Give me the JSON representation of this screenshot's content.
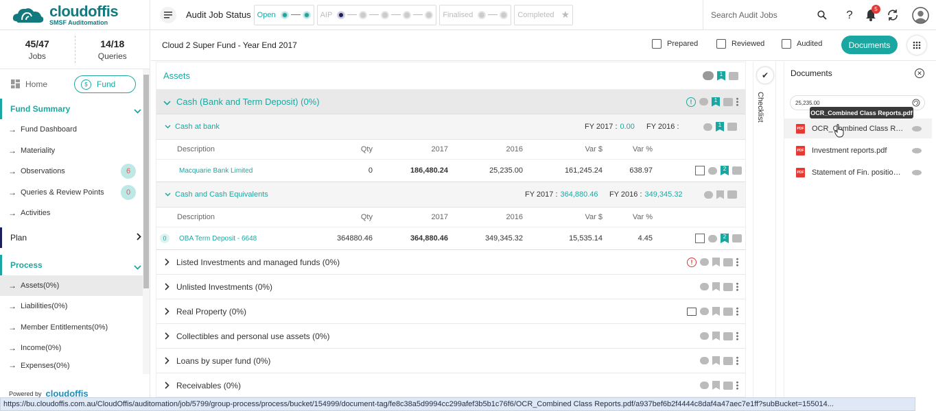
{
  "app": {
    "logo_name": "cloudoffis",
    "logo_sub": "SMSF Auditomation"
  },
  "topbar": {
    "title": "Audit Job Status",
    "stages": [
      {
        "label": "Open",
        "active": true
      },
      {
        "label": "AIP"
      },
      {
        "label": "Finalised"
      },
      {
        "label": "Completed"
      }
    ],
    "search_placeholder": "Search Audit Jobs",
    "notification_count": "5"
  },
  "sidebar": {
    "stats": [
      {
        "value": "45/47",
        "label": "Jobs"
      },
      {
        "value": "14/18",
        "label": "Queries"
      }
    ],
    "home_label": "Home",
    "fund_label": "Fund",
    "fund_icon_text": "$",
    "fund_summary_label": "Fund Summary",
    "fund_summary_items": [
      {
        "label": "Fund Dashboard"
      },
      {
        "label": "Materiality"
      },
      {
        "label": "Observations",
        "count": "6"
      },
      {
        "label": "Queries & Review Points",
        "count": "0"
      },
      {
        "label": "Activities"
      }
    ],
    "plan_label": "Plan",
    "process_label": "Process",
    "process_items": [
      {
        "label": "Assets(0%)"
      },
      {
        "label": "Liabilities(0%)"
      },
      {
        "label": "Member Entitlements(0%)"
      },
      {
        "label": "Income(0%)"
      },
      {
        "label": "Expenses(0%)"
      }
    ],
    "powered_by": "Powered by",
    "powered_brand": "cloudoffis"
  },
  "header": {
    "fund_title": "Cloud 2 Super Fund - Year End 2017",
    "prepared": "Prepared",
    "reviewed": "Reviewed",
    "audited": "Audited",
    "documents_button": "Documents"
  },
  "main": {
    "section_title": "Assets",
    "assets_flag_count": "1",
    "group": {
      "title": "Cash (Bank and Term Deposit) (0%)",
      "flag_count": "1"
    },
    "cash_at_bank": {
      "title": "Cash at bank",
      "fy2017_label": "FY 2017 :",
      "fy2017_value": "0.00",
      "fy2016_label": "FY 2016 :",
      "fy2016_value": "",
      "flag_count": "1",
      "columns": [
        "Description",
        "Qty",
        "2017",
        "2016",
        "Var $",
        "Var %"
      ],
      "rows": [
        {
          "description": "Macquarie Bank Limited",
          "qty": "0",
          "y2017": "186,480.24",
          "y2016": "25,235.00",
          "var_amt": "161,245.24",
          "var_pct": "638.97",
          "flag_count": "2"
        }
      ]
    },
    "cash_equiv": {
      "title": "Cash and Cash Equivalents",
      "fy2017_label": "FY 2017 :",
      "fy2017_value": "364,880.46",
      "fy2016_label": "FY 2016 :",
      "fy2016_value": "349,345.32",
      "columns": [
        "Description",
        "Qty",
        "2017",
        "2016",
        "Var $",
        "Var %"
      ],
      "rows": [
        {
          "badge": "0",
          "description": "OBA Term Deposit - 6648",
          "qty": "364880.46",
          "y2017": "364,880.46",
          "y2016": "349,345.32",
          "var_amt": "15,535.14",
          "var_pct": "4.45",
          "flag_count": "2"
        }
      ]
    },
    "categories": [
      {
        "label": "Listed Investments and managed funds (0%)"
      },
      {
        "label": "Unlisted Investments (0%)"
      },
      {
        "label": "Real Property (0%)"
      },
      {
        "label": "Collectibles and personal use assets (0%)"
      },
      {
        "label": "Loans by super fund (0%)"
      },
      {
        "label": "Receivables (0%)"
      }
    ]
  },
  "checklist": {
    "label": "Checklist"
  },
  "documents": {
    "title": "Documents",
    "search_value": "25,235.00",
    "tooltip": "OCR_Combined Class Reports.pdf",
    "items": [
      {
        "name": "OCR_Combined Class Reports.pdf"
      },
      {
        "name": "Investment reports.pdf"
      },
      {
        "name": "Statement of Fin. position ..."
      }
    ]
  },
  "statusbar": {
    "url": "https://bu.cloudoffis.com.au/CloudOffis/auditomation/job/5799/group-process/process/bucket/154999/document-tag/fe8c38a5d9994cc299afef3b5b1c76f6/OCR_Combined Class Reports.pdf/a937bef6b2f4444c8daf4a47aec7e1ff?subBucket=155014..."
  }
}
